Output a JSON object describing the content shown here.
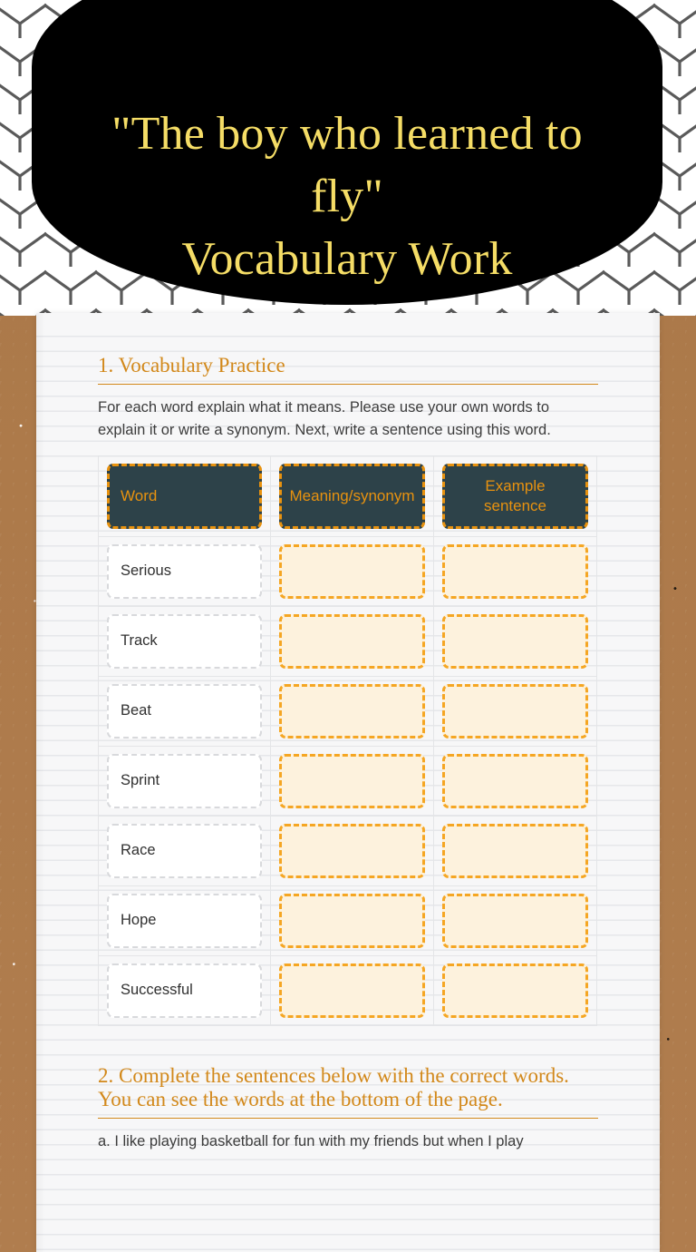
{
  "header": {
    "title": "\"The boy who learned to fly\"\nVocabulary Work",
    "banner_color": "#000000",
    "title_color": "#f5dd66"
  },
  "theme": {
    "accent_orange": "#d2881a",
    "header_cell_bg": "#2d4249",
    "header_cell_text": "#e8920f",
    "blank_cell_bg": "#fdf2dd",
    "blank_cell_border": "#f5a623",
    "board_color": "#b07d4e",
    "paper_color": "#f7f7f8",
    "body_text": "#3c3c3c"
  },
  "section1": {
    "heading": "1. Vocabulary Practice",
    "instructions": "For each word explain what it means. Please use your own words to explain it or write a synonym. Next, write a sentence using this word.",
    "table": {
      "headers": [
        "Word",
        "Meaning/synonym",
        "Example sentence"
      ],
      "rows": [
        {
          "word": "Serious",
          "meaning": "",
          "sentence": ""
        },
        {
          "word": "Track",
          "meaning": "",
          "sentence": ""
        },
        {
          "word": "Beat",
          "meaning": "",
          "sentence": ""
        },
        {
          "word": "Sprint",
          "meaning": "",
          "sentence": ""
        },
        {
          "word": "Race",
          "meaning": "",
          "sentence": ""
        },
        {
          "word": "Hope",
          "meaning": "",
          "sentence": ""
        },
        {
          "word": "Successful",
          "meaning": "",
          "sentence": ""
        }
      ]
    }
  },
  "section2": {
    "heading": "2. Complete the sentences below with the correct words. You can see the words at the bottom of the page.",
    "first_item": "a. I like playing basketball for fun with my friends but when I play"
  }
}
